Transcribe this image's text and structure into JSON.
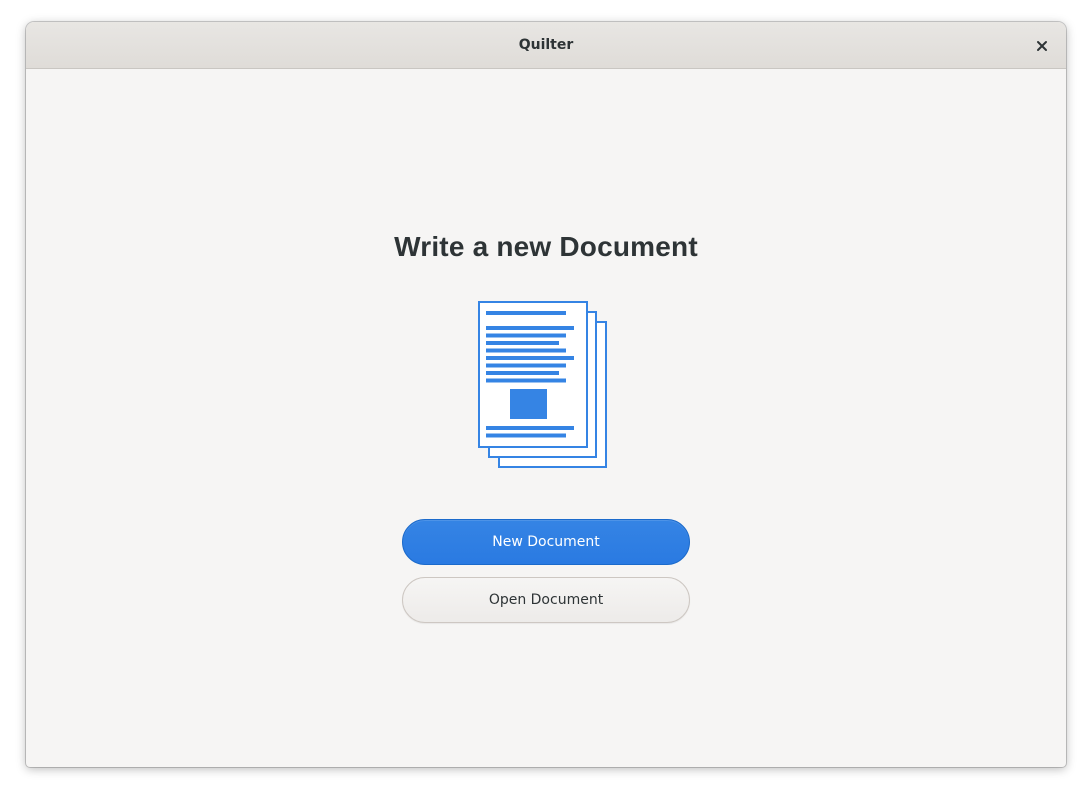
{
  "window": {
    "title": "Quilter"
  },
  "welcome": {
    "heading": "Write a new Document",
    "illustration_icon": "document-stack-icon",
    "new_button_label": "New Document",
    "open_button_label": "Open Document"
  },
  "colors": {
    "accent": "#3584e4",
    "background": "#f6f5f4",
    "text": "#2e3436"
  }
}
